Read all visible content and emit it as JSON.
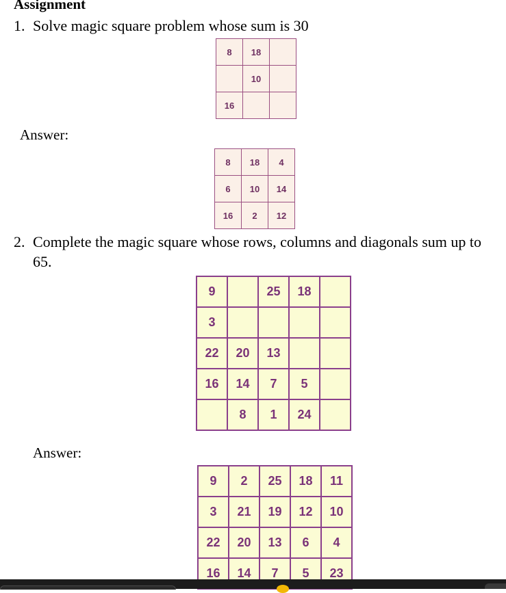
{
  "document": {
    "heading": "Assignment",
    "answer_label": "Answer:",
    "q1": {
      "number": "1.",
      "text": "Solve magic square problem whose sum is 30",
      "puzzle": [
        [
          "8",
          "18",
          ""
        ],
        [
          "",
          "10",
          ""
        ],
        [
          "16",
          "",
          ""
        ]
      ],
      "answer": [
        [
          "8",
          "18",
          "4"
        ],
        [
          "6",
          "10",
          "14"
        ],
        [
          "16",
          "2",
          "12"
        ]
      ]
    },
    "q2": {
      "number": "2.",
      "text_line1": "Complete the magic square whose rows, columns and diagonals sum up to",
      "text_line2": "65.",
      "puzzle": [
        [
          "9",
          "",
          "25",
          "18",
          ""
        ],
        [
          "3",
          "",
          "",
          "",
          ""
        ],
        [
          "22",
          "20",
          "13",
          "",
          ""
        ],
        [
          "16",
          "14",
          "7",
          "5",
          ""
        ],
        [
          "",
          "8",
          "1",
          "24",
          ""
        ]
      ],
      "answer": [
        [
          "9",
          "2",
          "25",
          "18",
          "11"
        ],
        [
          "3",
          "21",
          "19",
          "12",
          "10"
        ],
        [
          "22",
          "20",
          "13",
          "6",
          "4"
        ],
        [
          "16",
          "14",
          "7",
          "5",
          "23"
        ]
      ]
    }
  },
  "taskbar": {
    "background": "#1c1c1c",
    "accent": "#f2b705"
  }
}
